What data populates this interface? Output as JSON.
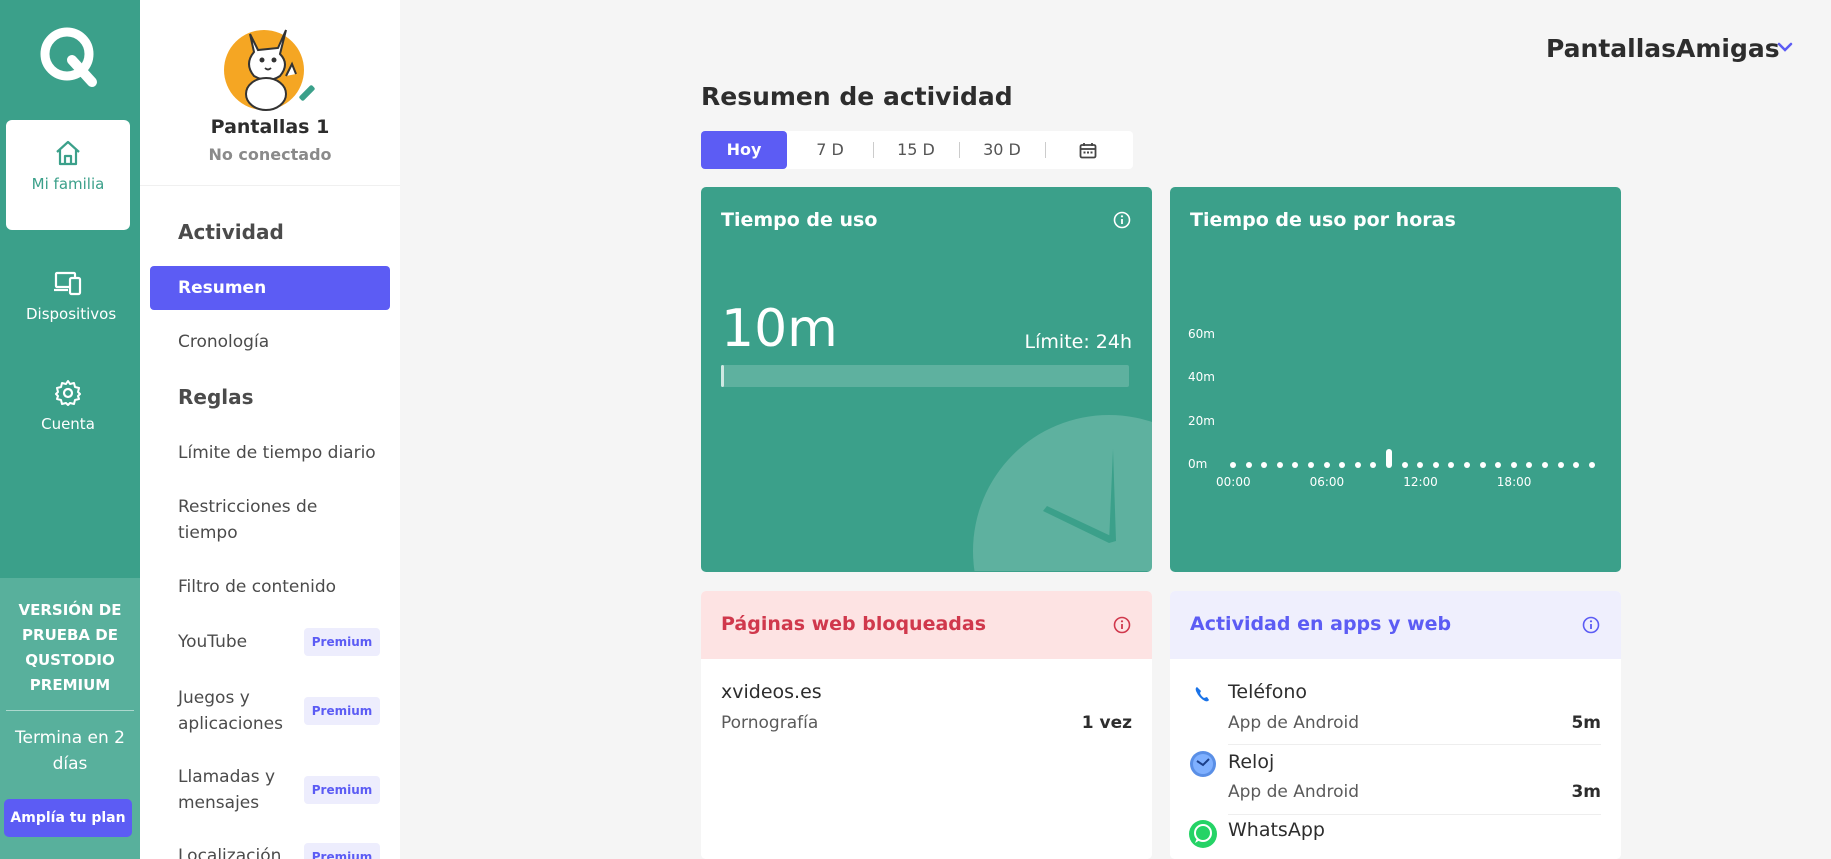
{
  "rail": {
    "items": [
      {
        "label": "Mi familia",
        "icon": "home-icon"
      },
      {
        "label": "Dispositivos",
        "icon": "devices-icon"
      },
      {
        "label": "Cuenta",
        "icon": "gear-icon"
      }
    ],
    "trial_title": "VERSIÓN DE PRUEBA DE QUSTODIO PREMIUM",
    "trial_ends": "Termina en 2 días",
    "upgrade_label": "Amplía tu plan"
  },
  "profile": {
    "name": "Pantallas 1",
    "status": "No conectado"
  },
  "sidebar": {
    "section_activity": "Actividad",
    "section_rules": "Reglas",
    "items": [
      {
        "label": "Resumen"
      },
      {
        "label": "Cronología"
      },
      {
        "label": "Límite de tiempo diario"
      },
      {
        "label": "Restricciones de tiempo"
      },
      {
        "label": "Filtro de contenido"
      },
      {
        "label": "YouTube",
        "badge": "Premium"
      },
      {
        "label": "Juegos y aplicaciones",
        "badge": "Premium"
      },
      {
        "label": "Llamadas y mensajes",
        "badge": "Premium"
      },
      {
        "label": "Localización",
        "badge": "Premium"
      }
    ]
  },
  "account": {
    "name": "PantallasAmigas"
  },
  "main": {
    "title": "Resumen de actividad",
    "periods": [
      "Hoy",
      "7 D",
      "15 D",
      "30 D"
    ],
    "selected_period": "Hoy"
  },
  "usage_card": {
    "title": "Tiempo de uso",
    "value": "10m",
    "limit": "Límite: 24h",
    "progress": 0.007
  },
  "hourly_card": {
    "title": "Tiempo de uso por horas"
  },
  "chart_data": {
    "type": "bar",
    "title": "Tiempo de uso por horas",
    "yticks": [
      "60m",
      "40m",
      "20m",
      "0m"
    ],
    "ylim": [
      0,
      60
    ],
    "xticks": [
      "00:00",
      "06:00",
      "12:00",
      "18:00"
    ],
    "x": [
      0,
      1,
      2,
      3,
      4,
      5,
      6,
      7,
      8,
      9,
      10,
      11,
      12,
      13,
      14,
      15,
      16,
      17,
      18,
      19,
      20,
      21,
      22,
      23
    ],
    "values": [
      0,
      0,
      0,
      0,
      0,
      0,
      0,
      0,
      0,
      0,
      10,
      0,
      0,
      0,
      0,
      0,
      0,
      0,
      0,
      0,
      0,
      0,
      0,
      0
    ]
  },
  "blocked_card": {
    "title": "Páginas web bloqueadas",
    "rows": [
      {
        "site": "xvideos.es",
        "category": "Pornografía",
        "count": "1 vez"
      }
    ]
  },
  "apps_card": {
    "title": "Actividad en apps y web",
    "rows": [
      {
        "name": "Teléfono",
        "type": "App de Android",
        "time": "5m",
        "icon": "phone-icon"
      },
      {
        "name": "Reloj",
        "type": "App de Android",
        "time": "3m",
        "icon": "clock-app-icon"
      },
      {
        "name": "WhatsApp",
        "type": "",
        "time": "",
        "icon": "whatsapp-icon"
      }
    ]
  },
  "colors": {
    "brand_green": "#3ba08a",
    "accent_purple": "#5c5cf4",
    "blocked_red": "#d0384c"
  }
}
